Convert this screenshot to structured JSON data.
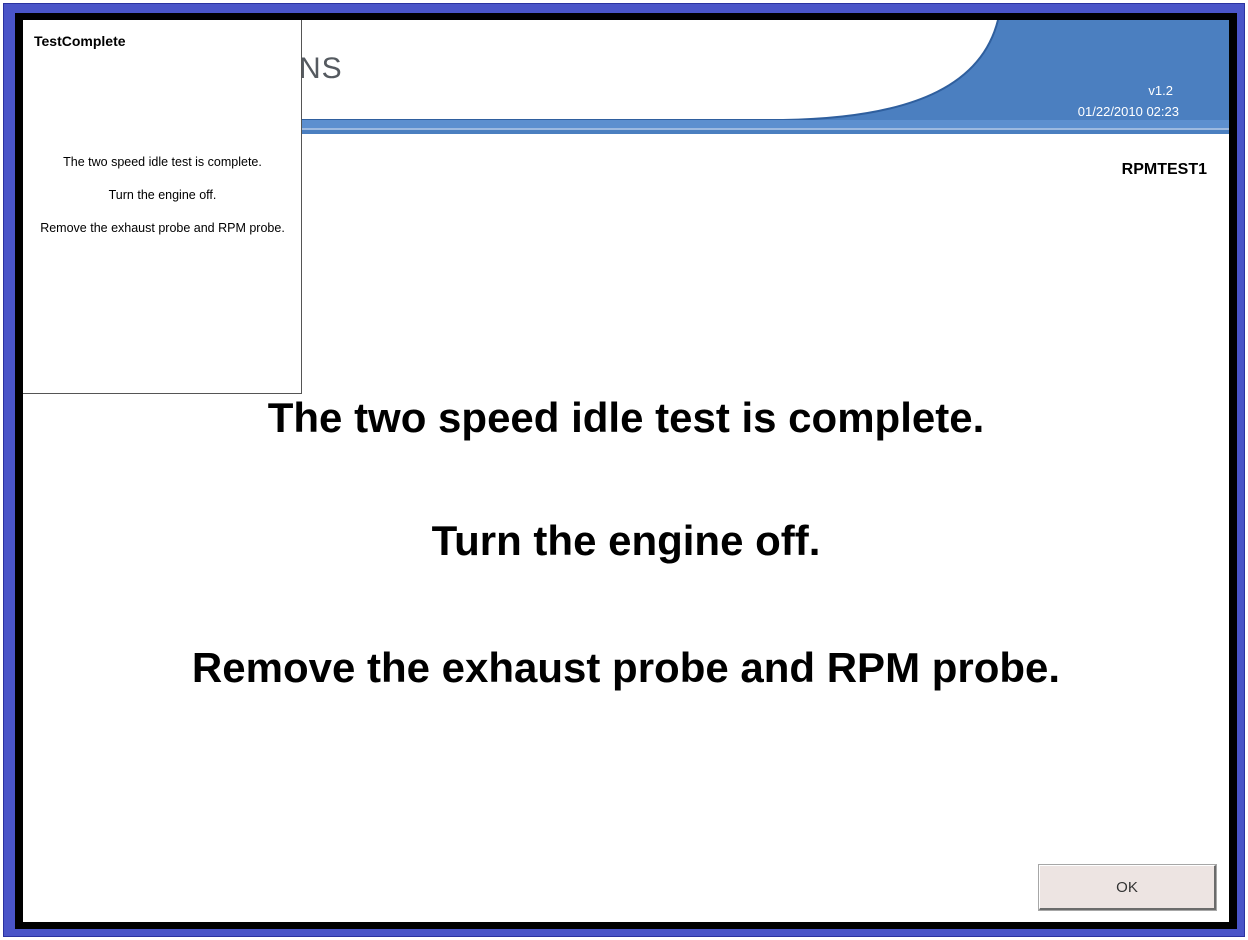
{
  "header": {
    "brand_text": "NS",
    "version": "v1.2",
    "datetime": "01/22/2010 02:23"
  },
  "screen_id": "RPMTEST1",
  "popup": {
    "title": "TestComplete",
    "lines": [
      "The two speed idle test is complete.",
      "Turn the engine off.",
      "Remove the exhaust probe and RPM probe."
    ]
  },
  "main": {
    "messages": [
      "The two speed idle test is complete.",
      "Turn the engine off.",
      "Remove the exhaust probe and RPM probe."
    ]
  },
  "buttons": {
    "ok_label": "OK"
  },
  "colors": {
    "frame_blue": "#4a55c8",
    "header_blue": "#4b7fc0",
    "brand_accent": "#f0a830"
  }
}
